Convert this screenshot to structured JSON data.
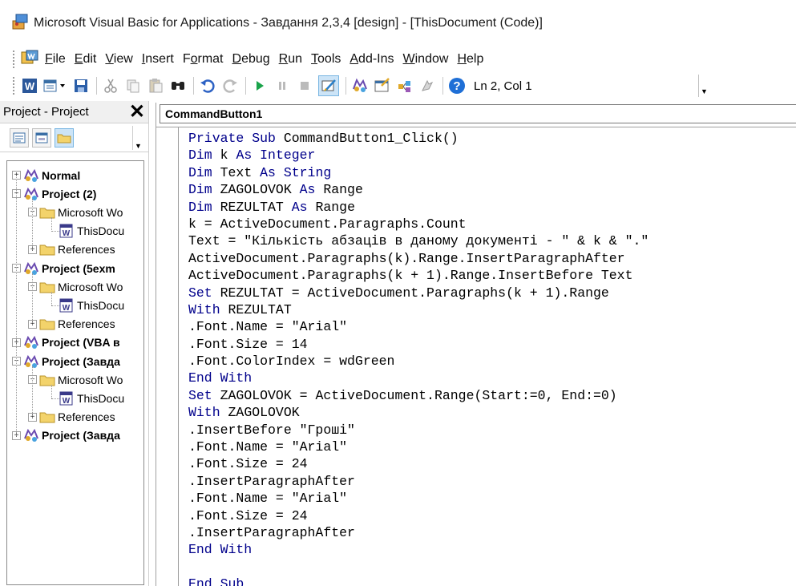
{
  "window": {
    "title": "Microsoft Visual Basic for Applications - Завдання 2,3,4 [design] - [ThisDocument (Code)]"
  },
  "menu": [
    {
      "label": "File",
      "accel": "F",
      "rest": "ile"
    },
    {
      "label": "Edit",
      "accel": "E",
      "rest": "dit"
    },
    {
      "label": "View",
      "accel": "V",
      "rest": "iew"
    },
    {
      "label": "Insert",
      "accel": "I",
      "rest": "nsert"
    },
    {
      "label": "Format",
      "pre": "F",
      "accel": "o",
      "rest": "rmat"
    },
    {
      "label": "Debug",
      "accel": "D",
      "rest": "ebug"
    },
    {
      "label": "Run",
      "accel": "R",
      "rest": "un"
    },
    {
      "label": "Tools",
      "accel": "T",
      "rest": "ools"
    },
    {
      "label": "Add-Ins",
      "accel": "A",
      "rest": "dd-Ins"
    },
    {
      "label": "Window",
      "accel": "W",
      "rest": "indow"
    },
    {
      "label": "Help",
      "accel": "H",
      "rest": "elp"
    }
  ],
  "toolbar": {
    "status": "Ln 2, Col 1",
    "icons": [
      "word-icon",
      "insert-module-icon",
      "save-icon",
      "cut-icon",
      "copy-icon",
      "paste-icon",
      "find-icon",
      "undo-icon",
      "redo-icon",
      "run-icon",
      "break-icon",
      "reset-icon",
      "design-mode-icon",
      "project-explorer-icon",
      "properties-icon",
      "object-browser-icon",
      "toolbox-icon",
      "help-icon"
    ]
  },
  "project_pane": {
    "title": "Project - Project",
    "tree": [
      {
        "label": "Normal",
        "bold": true,
        "level": 0,
        "type": "project",
        "expander": "+"
      },
      {
        "label": "Project (2)",
        "bold": true,
        "level": 0,
        "type": "project",
        "expander": "−"
      },
      {
        "label": "Microsoft Wo",
        "bold": false,
        "level": 1,
        "type": "folder",
        "expander": "−"
      },
      {
        "label": "ThisDocu",
        "bold": false,
        "level": 2,
        "type": "doc",
        "expander": ""
      },
      {
        "label": "References",
        "bold": false,
        "level": 1,
        "type": "folder",
        "expander": "+"
      },
      {
        "label": "Project (5exm",
        "bold": true,
        "level": 0,
        "type": "project",
        "expander": "−"
      },
      {
        "label": "Microsoft Wo",
        "bold": false,
        "level": 1,
        "type": "folder",
        "expander": "−"
      },
      {
        "label": "ThisDocu",
        "bold": false,
        "level": 2,
        "type": "doc",
        "expander": ""
      },
      {
        "label": "References",
        "bold": false,
        "level": 1,
        "type": "folder",
        "expander": "+"
      },
      {
        "label": "Project (VBA в",
        "bold": true,
        "level": 0,
        "type": "project",
        "expander": "+"
      },
      {
        "label": "Project (Завда",
        "bold": true,
        "level": 0,
        "type": "project",
        "expander": "−"
      },
      {
        "label": "Microsoft Wo",
        "bold": false,
        "level": 1,
        "type": "folder",
        "expander": "−"
      },
      {
        "label": "ThisDocu",
        "bold": false,
        "level": 2,
        "type": "doc",
        "expander": "",
        "selected": true
      },
      {
        "label": "References",
        "bold": false,
        "level": 1,
        "type": "folder",
        "expander": "+"
      },
      {
        "label": "Project (Завда",
        "bold": true,
        "level": 0,
        "type": "project",
        "expander": "+"
      }
    ]
  },
  "code_window": {
    "object_combo": "CommandButton1",
    "lines": [
      [
        {
          "t": "Private Sub",
          "k": 1
        },
        {
          "t": " CommandButton1_Click()"
        }
      ],
      [
        {
          "t": "Dim",
          "k": 1
        },
        {
          "t": " k "
        },
        {
          "t": "As Integer",
          "k": 1
        }
      ],
      [
        {
          "t": "Dim",
          "k": 1
        },
        {
          "t": " Text "
        },
        {
          "t": "As String",
          "k": 1
        }
      ],
      [
        {
          "t": "Dim",
          "k": 1
        },
        {
          "t": " ZAGOLOVOK "
        },
        {
          "t": "As",
          "k": 1
        },
        {
          "t": " Range"
        }
      ],
      [
        {
          "t": "Dim",
          "k": 1
        },
        {
          "t": " REZULTAT "
        },
        {
          "t": "As",
          "k": 1
        },
        {
          "t": " Range"
        }
      ],
      [
        {
          "t": "k = ActiveDocument.Paragraphs.Count"
        }
      ],
      [
        {
          "t": "Text = \"Кількість абзаців в даному документі - \" & k & \".\""
        }
      ],
      [
        {
          "t": "ActiveDocument.Paragraphs(k).Range.InsertParagraphAfter"
        }
      ],
      [
        {
          "t": "ActiveDocument.Paragraphs(k + 1).Range.InsertBefore Text"
        }
      ],
      [
        {
          "t": "Set",
          "k": 1
        },
        {
          "t": " REZULTAT = ActiveDocument.Paragraphs(k + 1).Range"
        }
      ],
      [
        {
          "t": "With",
          "k": 1
        },
        {
          "t": " REZULTAT"
        }
      ],
      [
        {
          "t": ".Font.Name = \"Arial\""
        }
      ],
      [
        {
          "t": ".Font.Size = 14"
        }
      ],
      [
        {
          "t": ".Font.ColorIndex = wdGreen"
        }
      ],
      [
        {
          "t": "End With",
          "k": 1
        }
      ],
      [
        {
          "t": "Set",
          "k": 1
        },
        {
          "t": " ZAGOLOVOK = ActiveDocument.Range(Start:=0, End:=0)"
        }
      ],
      [
        {
          "t": "With",
          "k": 1
        },
        {
          "t": " ZAGOLOVOK"
        }
      ],
      [
        {
          "t": ".InsertBefore \"Гроші\""
        }
      ],
      [
        {
          "t": ".Font.Name = \"Arial\""
        }
      ],
      [
        {
          "t": ".Font.Size = 24"
        }
      ],
      [
        {
          "t": ".InsertParagraphAfter"
        }
      ],
      [
        {
          "t": ".Font.Name = \"Arial\""
        }
      ],
      [
        {
          "t": ".Font.Size = 24"
        }
      ],
      [
        {
          "t": ".InsertParagraphAfter"
        }
      ],
      [
        {
          "t": "End With",
          "k": 1
        }
      ],
      [
        {
          "t": ""
        }
      ],
      [
        {
          "t": "End Sub",
          "k": 1
        }
      ]
    ]
  },
  "colors": {
    "keyword": "#00008b",
    "selection": "#0078d7"
  }
}
